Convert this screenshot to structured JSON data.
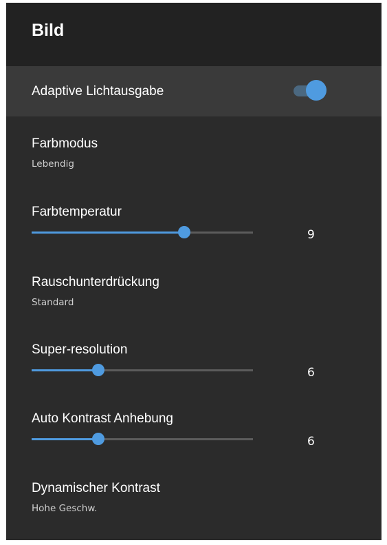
{
  "header": {
    "title": "Bild"
  },
  "items": {
    "adaptive_light": {
      "label": "Adaptive Lichtausgabe",
      "toggle_on": true
    },
    "color_mode": {
      "label": "Farbmodus",
      "value": "Lebendig"
    },
    "color_temperature": {
      "label": "Farbtemperatur",
      "value": "9",
      "level": 0.69
    },
    "noise_reduction": {
      "label": "Rauschunterdrückung",
      "value": "Standard"
    },
    "super_resolution": {
      "label": "Super-resolution",
      "value": "6",
      "level": 0.3
    },
    "auto_contrast": {
      "label": "Auto Kontrast Anhebung",
      "value": "6",
      "level": 0.3
    },
    "dynamic_contrast": {
      "label": "Dynamischer Kontrast",
      "value": "Hohe Geschw."
    }
  },
  "colors": {
    "accent": "#4f9be0",
    "background": "#2b2b2b",
    "header_background": "#222222",
    "focused_row": "#3a3a3a"
  }
}
